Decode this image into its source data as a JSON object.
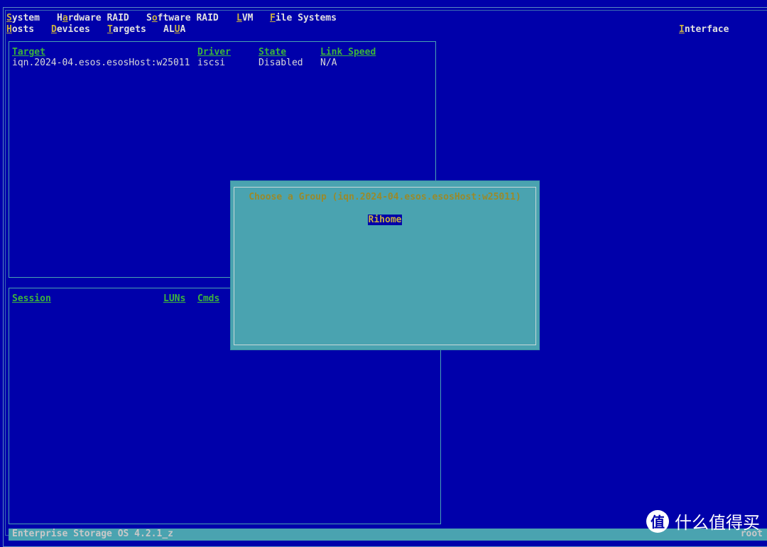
{
  "menu": {
    "row1": [
      {
        "hotkey_prefix": "",
        "hotkey": "S",
        "rest": "ystem"
      },
      {
        "hotkey_prefix": "H",
        "hotkey": "a",
        "rest": "rdware RAID"
      },
      {
        "hotkey_prefix": "S",
        "hotkey": "o",
        "rest": "ftware RAID"
      },
      {
        "hotkey_prefix": "",
        "hotkey": "L",
        "rest": "VM"
      },
      {
        "hotkey_prefix": "",
        "hotkey": "F",
        "rest": "ile Systems"
      }
    ],
    "row2": [
      {
        "hotkey_prefix": "",
        "hotkey": "H",
        "rest": "osts"
      },
      {
        "hotkey_prefix": "",
        "hotkey": "D",
        "rest": "evices"
      },
      {
        "hotkey_prefix": "",
        "hotkey": "T",
        "rest": "argets"
      },
      {
        "hotkey_prefix": "AL",
        "hotkey": "U",
        "rest": "A"
      }
    ],
    "interface": {
      "hotkey_prefix": "",
      "hotkey": "I",
      "rest": "nterface"
    }
  },
  "targets_panel": {
    "headers": [
      "Target",
      "Driver",
      "State",
      "Link Speed"
    ],
    "rows": [
      [
        "iqn.2024-04.esos.esosHost:w25011",
        "iscsi",
        "Disabled",
        "N/A"
      ]
    ]
  },
  "sessions_panel": {
    "headers": [
      "Session",
      "LUNs",
      "Cmds"
    ]
  },
  "dialog": {
    "title": "Choose a Group (iqn.2024-04.esos.esosHost:w25011)",
    "options": [
      "Rihome"
    ]
  },
  "status_bar": {
    "left": "Enterprise Storage OS 4.2.1_z",
    "right": "root"
  },
  "watermark": {
    "text": "什么值得买",
    "logo_char": "值"
  },
  "colors": {
    "background": "#0000aa",
    "accent": "#4aa3b0",
    "hotkey": "#c8b040",
    "header": "#3cb43c"
  }
}
